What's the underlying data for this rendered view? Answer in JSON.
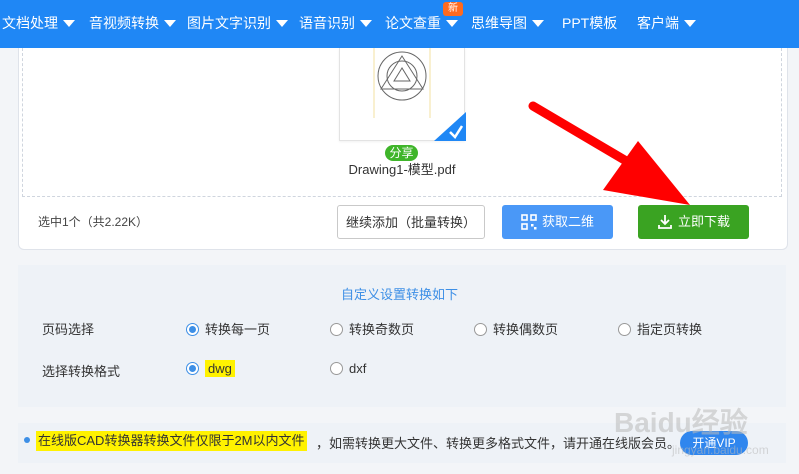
{
  "nav": {
    "items": [
      {
        "label": "文档处理"
      },
      {
        "label": "音视频转换"
      },
      {
        "label": "图片文字识别"
      },
      {
        "label": "语音识别"
      },
      {
        "label": "论文查重"
      },
      {
        "label": "思维导图"
      },
      {
        "label": "PPT模板"
      },
      {
        "label": "客户端"
      }
    ],
    "new_badge": "新"
  },
  "file": {
    "share_label": "分享",
    "name": "Drawing1-模型.pdf"
  },
  "actions": {
    "selected_info": "选中1个（共2.22K）",
    "continue_label": "继续添加（批量转换）",
    "qr_label": "获取二维",
    "download_label": "立即下载"
  },
  "settings": {
    "title": "自定义设置转换如下",
    "page_label": "页码选择",
    "page_options": [
      "转换每一页",
      "转换奇数页",
      "转换偶数页",
      "指定页转换"
    ],
    "page_selected": "转换每一页",
    "format_label": "选择转换格式",
    "format_options": [
      "dwg",
      "dxf"
    ],
    "format_selected": "dwg"
  },
  "notice": {
    "highlight": "在线版CAD转换器转换文件仅限于2M以内文件",
    "rest": "，如需转换更大文件、转换更多格式文件，请开通在线版会员。",
    "vip_label": "开通VIP"
  },
  "watermark": {
    "text": "Baidu经验",
    "url": "jingyan.baidu.com"
  },
  "colors": {
    "nav_bg": "#1f87f5",
    "download_green": "#3aa322",
    "qr_blue": "#4a98f7",
    "accent": "#3d8fe6",
    "highlight": "#fff200",
    "arrow_red": "#ff0000"
  }
}
